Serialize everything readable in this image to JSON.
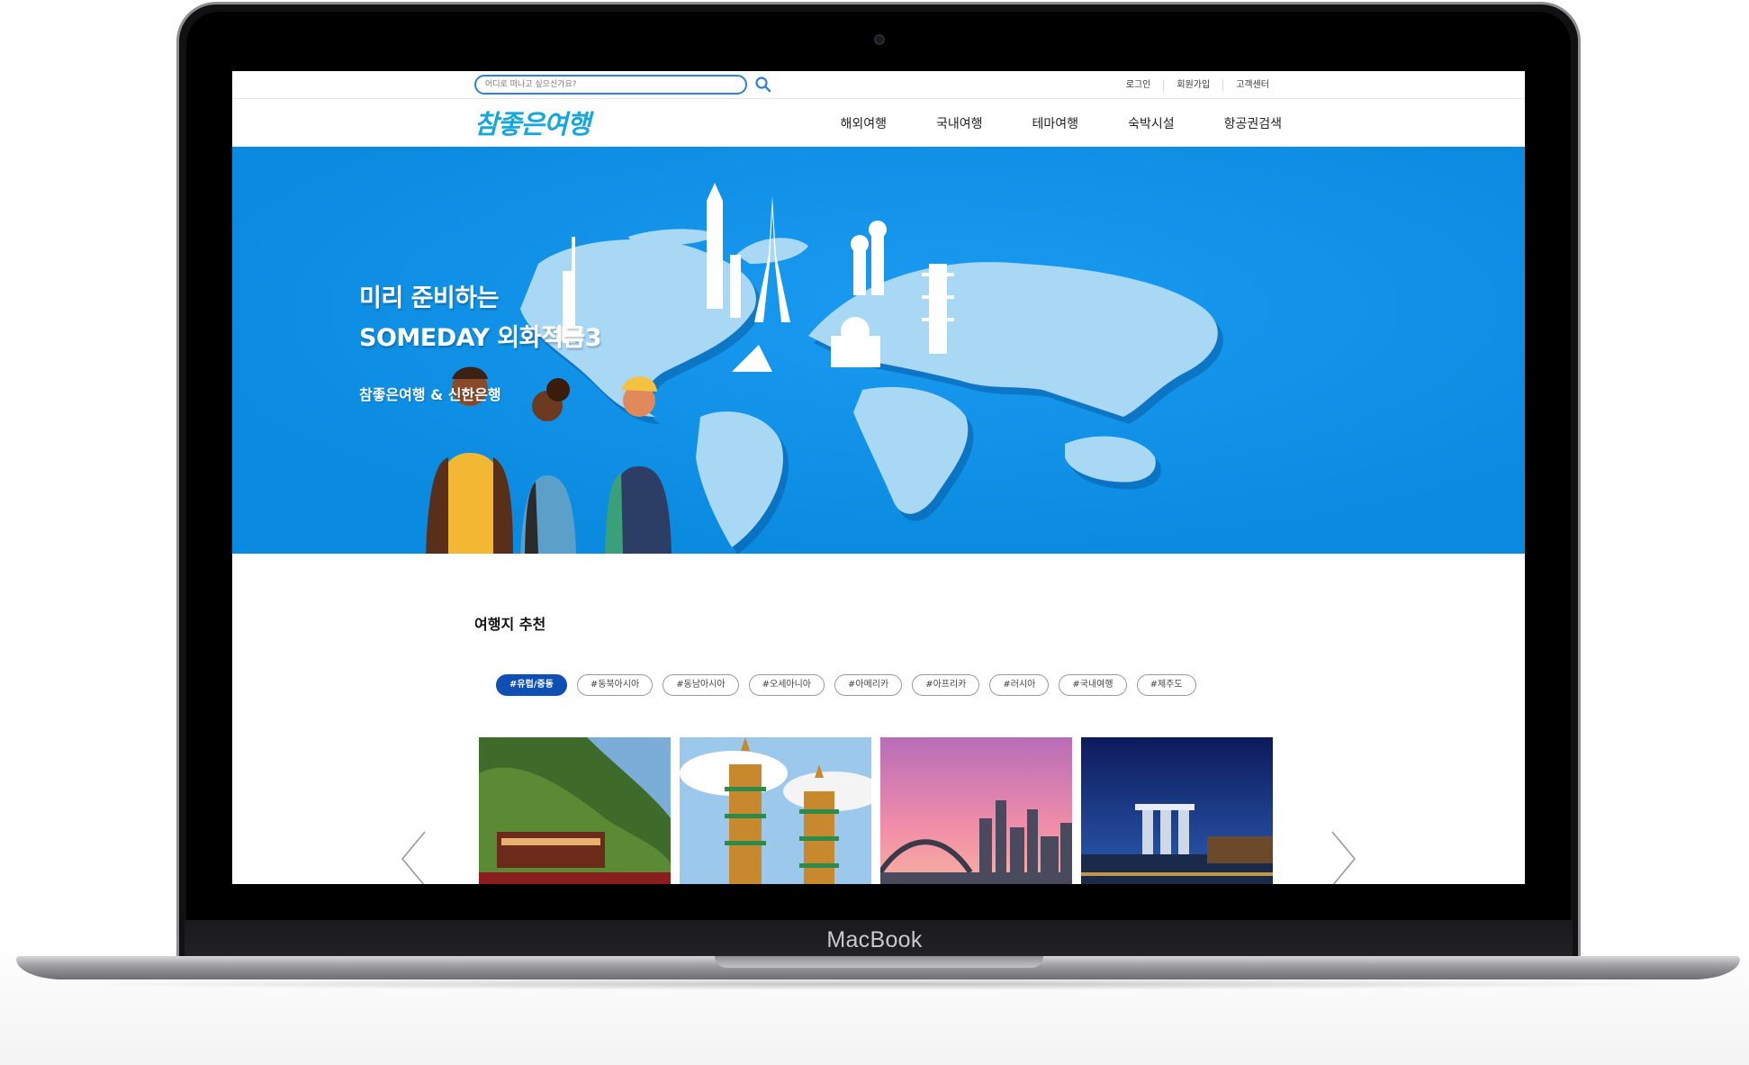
{
  "device": {
    "brand_label": "MacBook"
  },
  "topbar": {
    "search_placeholder": "어디로 떠나고 싶으신가요?",
    "search_icon": "search-icon",
    "links": [
      "로그인",
      "회원가입",
      "고객센터"
    ]
  },
  "header": {
    "logo_text": "참좋은여행",
    "menu": [
      "해외여행",
      "국내여행",
      "테마여행",
      "숙박시설",
      "항공권검색"
    ]
  },
  "hero": {
    "title_line1": "미리 준비하는",
    "title_line2": "SOMEDAY 외화적금3",
    "subtitle": "참좋은여행 & 신한은행",
    "background_color": "#0b8be0"
  },
  "recommend": {
    "title": "여행지 추천",
    "tags": [
      "#유럽/중동",
      "#동북아시아",
      "#동남아시아",
      "#오세아니아",
      "#아메리카",
      "#아프리카",
      "#러시아",
      "#국내여행",
      "#제주도"
    ],
    "active_tag": "#유럽/중동",
    "cards": [
      "mountain-village-photo",
      "twin-pagoda-photo",
      "harbour-bridge-city-photo",
      "marina-bay-night-photo"
    ],
    "prev_icon": "chevron-left-icon",
    "next_icon": "chevron-right-icon"
  },
  "colors": {
    "accent": "#0f4fb3",
    "logo": "#17a7d8",
    "search_border": "#2f7fd6"
  }
}
